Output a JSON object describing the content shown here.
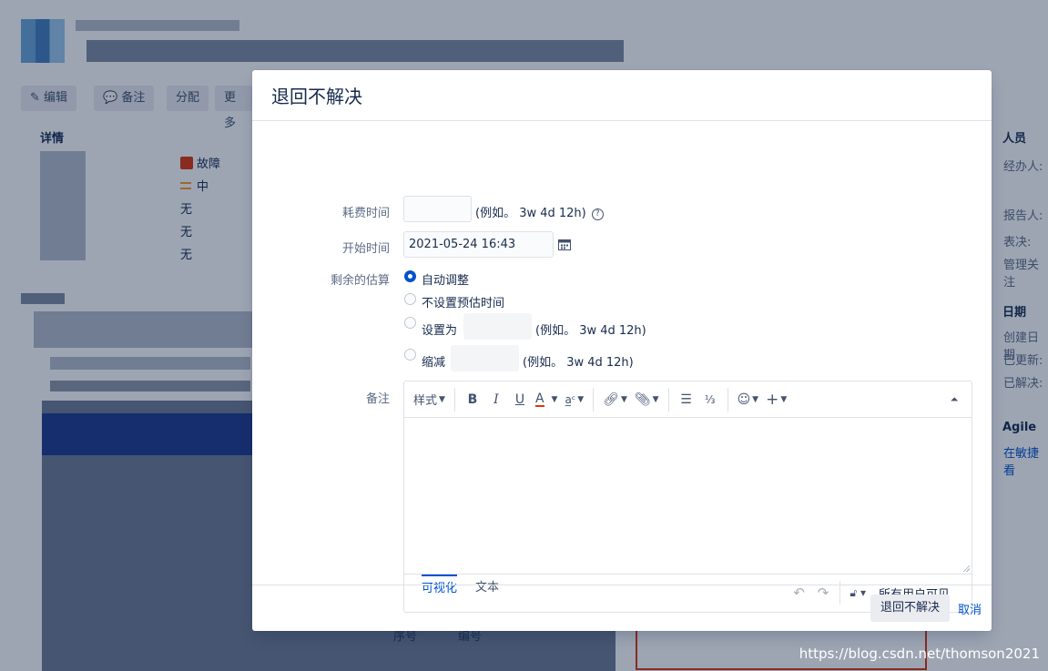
{
  "background": {
    "buttons": {
      "edit": "编辑",
      "comment": "备注",
      "assign": "分配",
      "more": "更多"
    },
    "details": {
      "heading": "详情",
      "type_value": "故障",
      "priority_value": "中",
      "none_1": "无",
      "none_2": "无",
      "none_3": "无"
    },
    "people": {
      "heading": "人员",
      "assignee": "经办人:",
      "reporter": "报告人:",
      "vote": "表决:",
      "watchers": "管理关注"
    },
    "dates": {
      "heading": "日期",
      "created": "创建日期",
      "updated": "已更新:",
      "resolved": "已解决:"
    },
    "agile": {
      "heading": "Agile",
      "link": "在敏捷看"
    },
    "lower": {
      "col1": "序号",
      "col2": "编号"
    }
  },
  "dialog": {
    "title": "退回不解决",
    "time_spent": {
      "label": "耗费时间",
      "value": "",
      "hint": "(例如。 3w 4d 12h)"
    },
    "start_time": {
      "label": "开始时间",
      "value": "2021-05-24 16:43"
    },
    "remaining": {
      "label": "剩余的估算",
      "options": [
        {
          "label": "自动调整",
          "selected": true
        },
        {
          "label": "不设置预估时间",
          "selected": false
        },
        {
          "label": "设置为",
          "hint": "(例如。 3w 4d 12h)",
          "selected": false
        },
        {
          "label": "缩减",
          "hint": "(例如。 3w 4d 12h)",
          "selected": false
        }
      ]
    },
    "comment": {
      "label": "备注",
      "toolbar": {
        "style": "样式",
        "bold": "B",
        "italic": "I",
        "underline": "U",
        "text_color": "A"
      },
      "tabs": {
        "visual": "可视化",
        "text": "文本"
      },
      "visibility": "所有用户可见"
    },
    "submit": "退回不解决",
    "cancel": "取消",
    "accent": "#0052cc"
  },
  "watermark": "https://blog.csdn.net/thomson2021"
}
